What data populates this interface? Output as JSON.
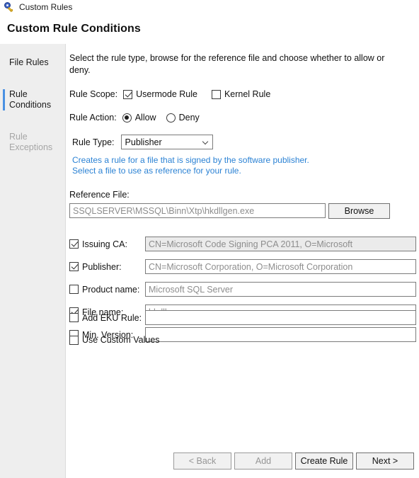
{
  "window": {
    "title": "Custom Rules",
    "icon": "key-lock-icon"
  },
  "header": {
    "page_title": "Custom Rule Conditions"
  },
  "sidebar": {
    "items": [
      {
        "label": "File Rules",
        "state": "normal"
      },
      {
        "label": "Rule Conditions",
        "state": "active"
      },
      {
        "label": "Rule Exceptions",
        "state": "disabled"
      }
    ]
  },
  "main": {
    "intro": "Select the rule type, browse for the reference file and choose whether to allow or deny.",
    "rule_scope": {
      "label": "Rule Scope:",
      "options": [
        {
          "label": "Usermode Rule",
          "checked": true
        },
        {
          "label": "Kernel Rule",
          "checked": false
        }
      ]
    },
    "rule_action": {
      "label": "Rule Action:",
      "options": [
        {
          "label": "Allow",
          "selected": true
        },
        {
          "label": "Deny",
          "selected": false
        }
      ]
    },
    "rule_type": {
      "label": "Rule Type:",
      "value": "Publisher",
      "chevron": "chevron-down-icon"
    },
    "hint_line_1": "Creates a rule for a file that is signed by the software publisher.",
    "hint_line_2": "Select a file to use as reference for your rule.",
    "reference_file": {
      "label": "Reference File:",
      "value": "SSQLSERVER\\MSSQL\\Binn\\Xtp\\hkdllgen.exe",
      "browse_label": "Browse"
    },
    "conditions": [
      {
        "label": "Issuing CA:",
        "checked": true,
        "value": "CN=Microsoft Code Signing PCA 2011, O=Microsoft",
        "readonly": true
      },
      {
        "label": "Publisher:",
        "checked": true,
        "value": "CN=Microsoft Corporation, O=Microsoft Corporation",
        "readonly": false
      },
      {
        "label": "Product name:",
        "checked": false,
        "value": "Microsoft SQL Server",
        "readonly": false
      },
      {
        "label": "File name:",
        "checked": true,
        "value": "hkdllgen.exe",
        "readonly": false
      },
      {
        "label": "Min. Version:",
        "checked": false,
        "value": "",
        "readonly": false
      }
    ],
    "eku_rule": {
      "label": "Add EKU Rule:",
      "checked": false,
      "value": ""
    },
    "use_custom_values": {
      "label": "Use Custom Values",
      "checked": false
    }
  },
  "footer": {
    "buttons": [
      {
        "label": "< Back",
        "enabled": false
      },
      {
        "label": "Add",
        "enabled": false
      },
      {
        "label": "Create Rule",
        "enabled": true
      },
      {
        "label": "Next >",
        "enabled": true
      }
    ]
  },
  "colors": {
    "accent": "#4a90e2",
    "hint": "#2b82d4",
    "sidebar_bg": "#eeeeee",
    "disabled_text": "#a6a6a6"
  }
}
